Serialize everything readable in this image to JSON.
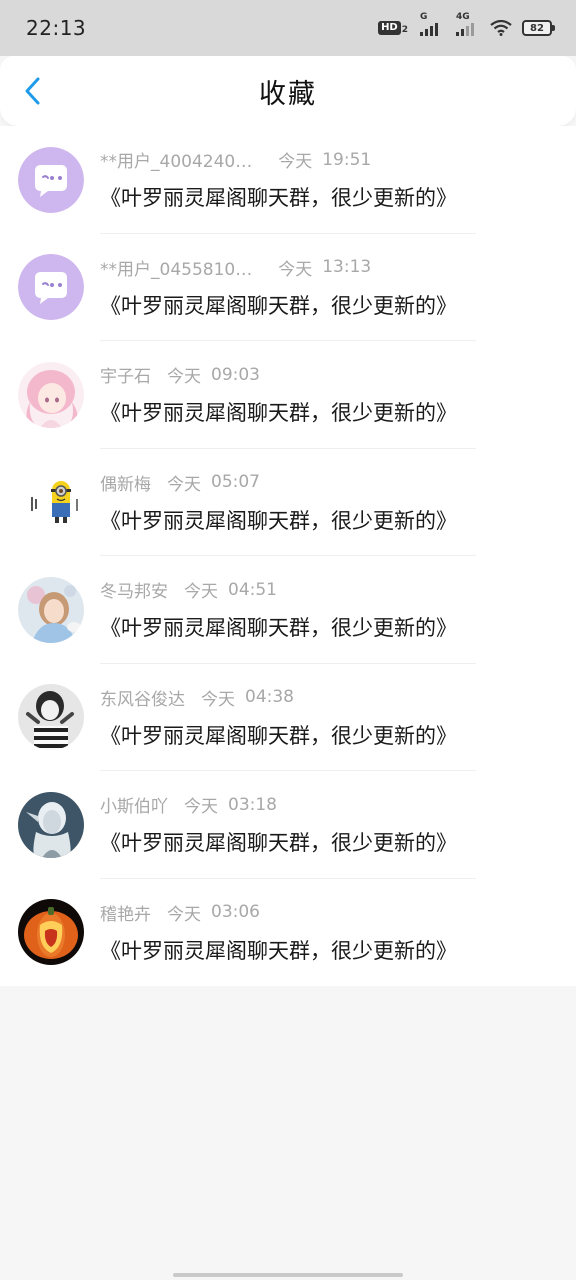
{
  "status_bar": {
    "time": "22:13",
    "network_hd": "HD",
    "network_2": "2",
    "sig1_label": "G",
    "sig2_label": "4G",
    "battery": "82"
  },
  "header": {
    "title": "收藏"
  },
  "colors": {
    "accent": "#1e9bea",
    "chat_avatar_bg": "#cdb7ee"
  },
  "favorites": [
    {
      "name": "**用户_4004240…",
      "date": "今天",
      "time": "19:51",
      "message": "《叶罗丽灵犀阁聊天群，很少更新的》",
      "avatar_icon": "chat-bubble-icon"
    },
    {
      "name": "**用户_0455810…",
      "date": "今天",
      "time": "13:13",
      "message": "《叶罗丽灵犀阁聊天群，很少更新的》",
      "avatar_icon": "chat-bubble-icon"
    },
    {
      "name": "宇子石",
      "date": "今天",
      "time": "09:03",
      "message": "《叶罗丽灵犀阁聊天群，很少更新的》",
      "avatar_icon": "anime-girl-avatar"
    },
    {
      "name": "偶新梅",
      "date": "今天",
      "time": "05:07",
      "message": "《叶罗丽灵犀阁聊天群，很少更新的》",
      "avatar_icon": "minion-avatar"
    },
    {
      "name": "冬马邦安",
      "date": "今天",
      "time": "04:51",
      "message": "《叶罗丽灵犀阁聊天群，很少更新的》",
      "avatar_icon": "girl-photo-avatar"
    },
    {
      "name": "东风谷俊达",
      "date": "今天",
      "time": "04:38",
      "message": "《叶罗丽灵犀阁聊天群，很少更新的》",
      "avatar_icon": "bw-girl-avatar"
    },
    {
      "name": "小斯伯吖",
      "date": "今天",
      "time": "03:18",
      "message": "《叶罗丽灵犀阁聊天群，很少更新的》",
      "avatar_icon": "elf-avatar"
    },
    {
      "name": "稽艳卉",
      "date": "今天",
      "time": "03:06",
      "message": "《叶罗丽灵犀阁聊天群，很少更新的》",
      "avatar_icon": "pumpkin-avatar"
    }
  ]
}
